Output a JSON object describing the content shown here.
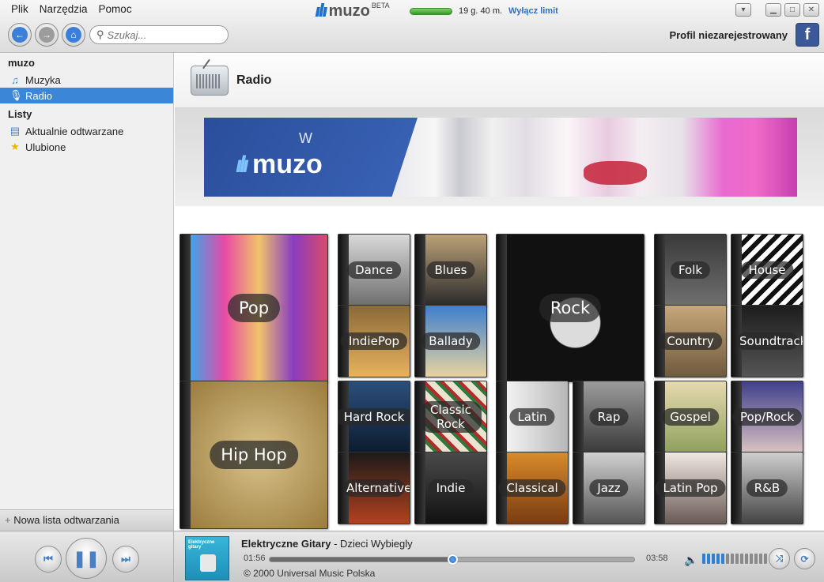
{
  "menu": [
    "Plik",
    "Narzędzia",
    "Pomoc"
  ],
  "brand": {
    "name": "muzo",
    "beta": "BETA",
    "logo_icon": "muzo-logo"
  },
  "limit": {
    "time": "19 g. 40 m.",
    "link": "Wyłącz limit",
    "level": 1.0
  },
  "search": {
    "placeholder": "Szukaj..."
  },
  "profile": {
    "label": "Profil niezarejestrowany",
    "fb": "f"
  },
  "sidebar": {
    "head1": "muzo",
    "items": [
      {
        "label": "Muzyka",
        "icon": "music-note-icon"
      },
      {
        "label": "Radio",
        "icon": "microphone-icon"
      }
    ],
    "head2": "Listy",
    "lists": [
      {
        "label": "Aktualnie odtwarzane",
        "icon": "playlist-icon"
      },
      {
        "label": "Ulubione",
        "icon": "star-icon"
      }
    ],
    "new_list": "Nowa lista odtwarzania"
  },
  "main": {
    "title": "Radio",
    "banner": {
      "w": "W",
      "brand": "muzo"
    }
  },
  "genres": [
    {
      "label": "Pop",
      "big": true,
      "bg": "linear-gradient(90deg,#3fa3e8,#e84aa5,#f0c36a,#8a3cc2,#d94a6a)"
    },
    {
      "label": "Dance",
      "bg": "linear-gradient(#d9d9d9,#6e6e6e)"
    },
    {
      "label": "Blues",
      "bg": "linear-gradient(#bba178,#2b2b2b)"
    },
    {
      "label": "Rock",
      "big": true,
      "bg": "radial-gradient(circle at 50% 60%,#dcdcdc 0 22%,#111 23%)"
    },
    {
      "label": "Folk",
      "bg": "linear-gradient(#3a3a3a,#6f6f6f)"
    },
    {
      "label": "House",
      "bg": "repeating-linear-gradient(135deg,#fff 0 6px,#111 6px 12px)"
    },
    {
      "label": "IndiePop",
      "bg": "linear-gradient(#8a6a3a,#e6b35c)"
    },
    {
      "label": "Ballady",
      "bg": "linear-gradient(#3d7fcf,#e7d3a0)"
    },
    {
      "label": "Country",
      "bg": "linear-gradient(#c7a77a,#6f5a3c)"
    },
    {
      "label": "Soundtracks",
      "bg": "linear-gradient(#1d1d1d,#555)"
    },
    {
      "label": "Hip Hop",
      "big": true,
      "bg": "radial-gradient(circle,#d8c28a,#9c7c3e)"
    },
    {
      "label": "Hard Rock",
      "bg": "linear-gradient(#2a4f7c,#0d1c2e)"
    },
    {
      "label": "Classic Rock",
      "bg": "repeating-linear-gradient(45deg,#e9e3cf 0 8px,#2d7a3e 8px 12px,#b42b2b 12px 16px)"
    },
    {
      "label": "Latin",
      "bg": "linear-gradient(90deg,#f2f2f2,#b7b7b7)"
    },
    {
      "label": "Rap",
      "bg": "linear-gradient(#9c9c9c,#3a3a3a)"
    },
    {
      "label": "Gospel",
      "bg": "linear-gradient(#e6d9b0,#8fa05c)"
    },
    {
      "label": "Pop/Rock",
      "bg": "linear-gradient(#3f3f8c,#d9c2c2)"
    },
    {
      "label": "Alternative",
      "bg": "linear-gradient(#1a1a1a,#b3411f)"
    },
    {
      "label": "Indie",
      "bg": "linear-gradient(#4a4a4a,#111)"
    },
    {
      "label": "Classical",
      "bg": "linear-gradient(#d88b2a,#7a3c12)"
    },
    {
      "label": "Jazz",
      "bg": "linear-gradient(#d1d1d1,#555)"
    },
    {
      "label": "Latin Pop",
      "bg": "linear-gradient(#efe8e0,#6b5a56)"
    },
    {
      "label": "R&B",
      "bg": "linear-gradient(#cfcfcf,#444)"
    }
  ],
  "player": {
    "artist": "Elektryczne Gitary",
    "sep": " - ",
    "song": "Dzieci Wybiegly",
    "current": "01:56",
    "duration": "03:58",
    "progress": 0.503,
    "copyright": "© 2000 Universal Music Polska",
    "cover_text": "Elektryczne gitary",
    "volume_bars": 14,
    "volume_level": 5,
    "colors": {
      "accent": "#3c86d8",
      "vol_on": "#2f7fd3",
      "vol_off": "#8a8a8a"
    }
  }
}
